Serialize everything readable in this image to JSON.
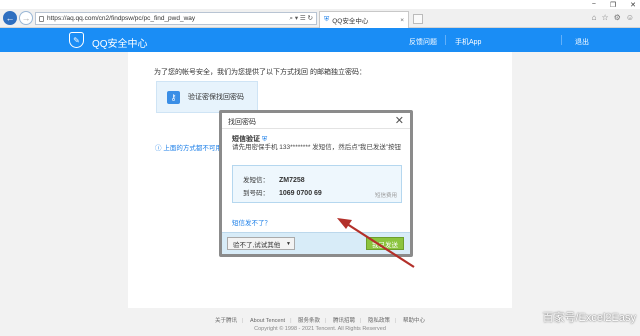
{
  "browser": {
    "url": "https://aq.qq.com/cn2/findpsw/pc/pc_find_pwd_way",
    "url_controls": "⌕ ▾ ☰ ↻",
    "tab_title": "QQ安全中心",
    "tab_close": "×",
    "window_buttons": [
      "−",
      "❐",
      "✕"
    ],
    "right_icons": [
      "⌂",
      "☆",
      "⚙",
      "☺"
    ]
  },
  "header": {
    "site_title": "QQ安全中心",
    "links": [
      "反馈问题",
      "手机App",
      "退出"
    ]
  },
  "page": {
    "intro_text": "为了您的帐号安全，我们为您提供了以下方式找回                              的邮箱独立密码：",
    "option_label": "验证密保找回密码",
    "info_text": "上面的方式都不可用"
  },
  "dialog": {
    "title": "找回密码",
    "close": "✕",
    "subtitle": "短信验证",
    "description": "请先用密保手机 133******** 发短信，然后点“我已发送”按钮",
    "sms_content_label": "发短信：",
    "sms_content_value": "ZM7258",
    "sms_to_label": "到号码：",
    "sms_to_value": "1069 0700 69",
    "sms_fee": "短信费用",
    "sms_fail_link": "短信发不了？",
    "alt_button": "验不了,试试其他",
    "sent_button": "我已发送"
  },
  "footer": {
    "links": [
      "关于腾讯",
      "About Tencent",
      "服务条款",
      "腾讯招聘",
      "隐私政策",
      "帮助中心"
    ],
    "copyright": "Copyright © 1998 - 2021 Tencent. All Rights Reserved",
    "watermark": "百家号/Excel2Easy"
  },
  "colors": {
    "header_blue": "#1a8df5",
    "link_blue": "#1a7ee8",
    "sent_green": "#8bc43e",
    "arrow_red": "#b3302a"
  }
}
